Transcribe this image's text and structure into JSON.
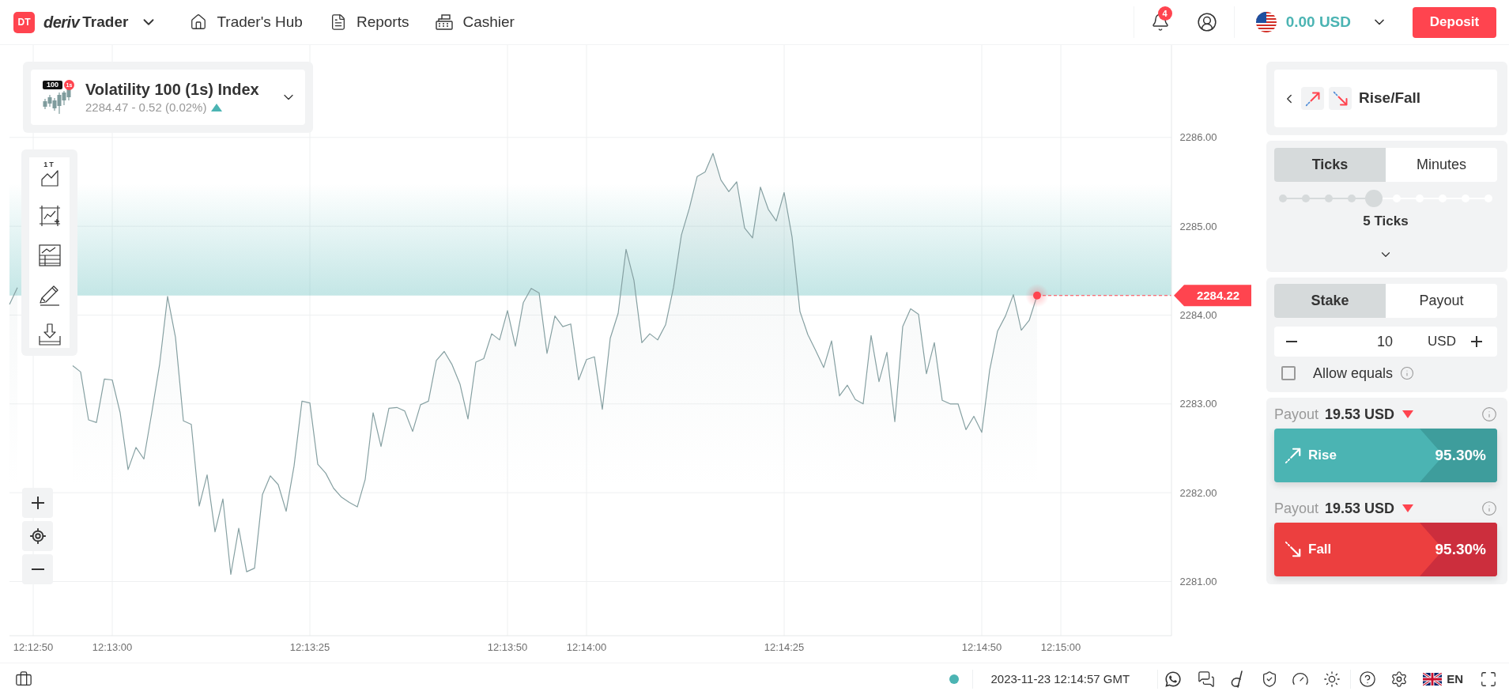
{
  "header": {
    "logo": {
      "badge": "DT",
      "brand": "deriv",
      "product": "Trader"
    },
    "nav": [
      {
        "label": "Trader's Hub"
      },
      {
        "label": "Reports"
      },
      {
        "label": "Cashier"
      }
    ],
    "notifications": {
      "count": "4"
    },
    "balance": {
      "amount": "0.00 USD"
    },
    "deposit_button": "Deposit"
  },
  "symbol": {
    "icon_label": "100",
    "icon_badge": "1s",
    "name": "Volatility 100 (1s) Index",
    "quote": "2284.47 - 0.52 (0.02%)",
    "rising": true
  },
  "chart_toolbar": {
    "chart_type_label": "1T"
  },
  "chart": {
    "chart_data": {
      "type": "area",
      "grid": true,
      "categories": [
        null,
        null,
        null,
        "12:12:50",
        null,
        null,
        null,
        null,
        null,
        null,
        null,
        null,
        null,
        "12:13:00",
        null,
        null,
        null,
        null,
        null,
        null,
        null,
        null,
        null,
        null,
        null,
        null,
        null,
        null,
        null,
        null,
        null,
        null,
        null,
        null,
        null,
        null,
        null,
        null,
        "12:13:25",
        null,
        null,
        null,
        null,
        null,
        null,
        null,
        null,
        null,
        null,
        null,
        null,
        null,
        null,
        null,
        null,
        null,
        null,
        null,
        null,
        null,
        null,
        null,
        null,
        "12:13:50",
        null,
        null,
        null,
        null,
        null,
        null,
        null,
        null,
        null,
        "12:14:00",
        null,
        null,
        null,
        null,
        null,
        null,
        null,
        null,
        null,
        null,
        null,
        null,
        null,
        null,
        null,
        null,
        null,
        null,
        null,
        null,
        null,
        null,
        null,
        null,
        "12:14:25",
        null,
        null,
        null,
        null,
        null,
        null,
        null,
        null,
        null,
        null,
        null,
        null,
        null,
        null,
        null,
        null,
        null,
        null,
        null,
        null,
        null,
        null,
        null,
        null,
        "12:14:50",
        null,
        null,
        null,
        null,
        null,
        null,
        null,
        null,
        null,
        "12:15:00",
        null,
        null,
        null,
        null,
        null,
        null,
        null,
        null,
        null,
        null,
        null,
        null,
        null,
        null
      ],
      "values": [
        2284.12,
        2284.31,
        null,
        null,
        null,
        null,
        null,
        null,
        2283.43,
        2283.36,
        2282.82,
        2282.79,
        2283.28,
        2283.27,
        2282.9,
        2282.26,
        2282.51,
        2282.38,
        2282.9,
        2283.45,
        2284.21,
        2283.75,
        2282.81,
        2282.77,
        2281.85,
        2282.2,
        2281.56,
        2281.93,
        2281.08,
        2281.6,
        2281.11,
        2281.15,
        2281.98,
        2282.19,
        2282.09,
        2281.79,
        2282.3,
        2283.03,
        2283.01,
        2282.32,
        2282.22,
        2282.05,
        2281.95,
        2281.89,
        2281.84,
        2282.15,
        2282.9,
        2282.52,
        2282.95,
        2282.96,
        2282.92,
        2282.69,
        2282.99,
        2283.03,
        2283.49,
        2283.59,
        2283.44,
        2283.22,
        2282.83,
        2283.47,
        2283.51,
        2283.79,
        2283.72,
        2284.05,
        2283.65,
        2284.14,
        2284.3,
        2284.25,
        2283.57,
        2283.99,
        2283.87,
        2283.9,
        2283.27,
        2283.5,
        2283.53,
        2282.94,
        2283.74,
        2284.02,
        2284.74,
        2284.39,
        2283.69,
        2283.79,
        2283.72,
        2283.89,
        2284.31,
        2284.9,
        2285.2,
        2285.56,
        2285.61,
        2285.82,
        2285.52,
        2285.39,
        2285.5,
        2284.98,
        2284.87,
        2285.44,
        2285.19,
        2285.06,
        2285.38,
        2284.88,
        2284.04,
        2283.78,
        2283.6,
        2283.41,
        2283.71,
        2283.09,
        2283.21,
        2283.05,
        2283.0,
        2283.77,
        2283.25,
        2283.58,
        2282.8,
        2283.87,
        2284.07,
        2284.01,
        2283.34,
        2283.69,
        2283.04,
        2283.0,
        2283.0,
        2282.71,
        2282.86,
        2282.68,
        2283.38,
        2283.82,
        2283.99,
        2284.23,
        2283.83,
        2283.94,
        2284.22,
        null,
        null,
        null,
        null,
        null,
        null,
        null,
        null,
        null,
        null,
        null,
        null,
        null,
        null,
        null,
        null,
        null
      ],
      "ylim": [
        2280.39,
        2287.04
      ],
      "yticks": [
        {
          "value": 2281,
          "label": "2281.00"
        },
        {
          "value": 2282,
          "label": "2282.00"
        },
        {
          "value": 2283,
          "label": "2283.00"
        },
        {
          "value": 2284,
          "label": "2284.00"
        },
        {
          "value": 2285,
          "label": "2285.00"
        },
        {
          "value": 2286,
          "label": "2286.00"
        }
      ],
      "bands": [
        {
          "axis": "y",
          "from": 2284.22,
          "to": 2285.48,
          "color": "#4bb4b3"
        }
      ],
      "ref_lines": [
        {
          "axis": "y",
          "value": 2284.22,
          "color": "#ff444f"
        }
      ]
    },
    "spot_label": "2284.22"
  },
  "trade": {
    "contract": {
      "name": "Rise/Fall"
    },
    "duration": {
      "tabs": [
        {
          "label": "Ticks",
          "selected": true
        },
        {
          "label": "Minutes",
          "selected": false
        }
      ],
      "slider": {
        "level": 0.444
      },
      "value_label": "5 Ticks"
    },
    "amount": {
      "tabs": [
        {
          "label": "Stake",
          "selected": true
        },
        {
          "label": "Payout",
          "selected": false
        }
      ],
      "value": "10",
      "currency": "USD",
      "allow_equals": {
        "label": "Allow equals",
        "checked": false
      }
    },
    "purchase": [
      {
        "kind": "rise",
        "payout_label": "Payout",
        "payout": "19.53 USD",
        "payout_rising": false,
        "label": "Rise",
        "percentage": "95.30%"
      },
      {
        "kind": "fall",
        "payout_label": "Payout",
        "payout": "19.53 USD",
        "payout_rising": false,
        "label": "Fall",
        "percentage": "95.30%"
      }
    ]
  },
  "footer": {
    "online": true,
    "timestamp": "2023-11-23 12:14:57 GMT",
    "language": "EN"
  }
}
